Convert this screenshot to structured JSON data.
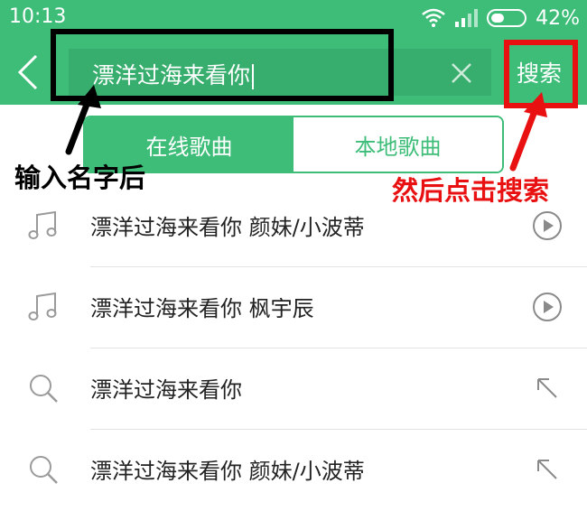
{
  "status_bar": {
    "time": "10:13",
    "battery": "42%",
    "battery_level": 0.42
  },
  "search": {
    "query": "漂洋过海来看你",
    "search_label": "搜索"
  },
  "tabs": [
    {
      "label": "在线歌曲",
      "active": true
    },
    {
      "label": "本地歌曲",
      "active": false
    }
  ],
  "annotations": {
    "left": "输入名字后",
    "right": "然后点击搜索"
  },
  "results": [
    {
      "icon": "music-note-icon",
      "text": "漂洋过海来看你 颜妹/小波蒂",
      "action_icon": "play-icon"
    },
    {
      "icon": "music-note-icon",
      "text": "漂洋过海来看你 枫宇辰",
      "action_icon": "play-icon"
    },
    {
      "icon": "search-icon",
      "text": "漂洋过海来看你",
      "action_icon": "fill-arrow-icon"
    },
    {
      "icon": "search-icon",
      "text": "漂洋过海来看你 颜妹/小波蒂",
      "action_icon": "fill-arrow-icon"
    }
  ],
  "colors": {
    "brand_green": "#3dbd78",
    "annotation_red": "#e81010"
  }
}
